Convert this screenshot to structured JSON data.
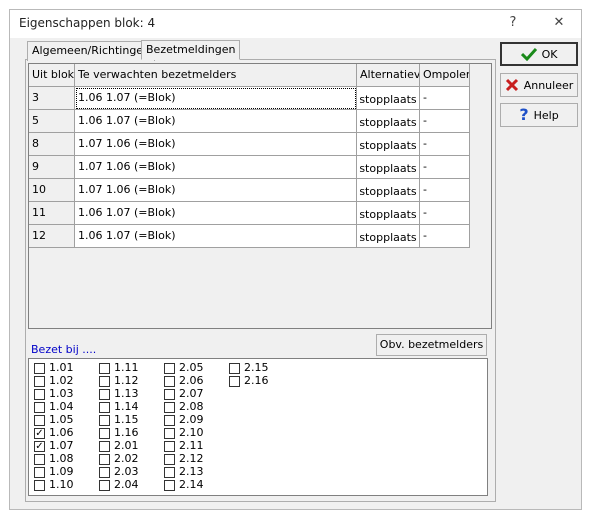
{
  "window": {
    "title": "Eigenschappen blok: 4",
    "help_glyph": "?",
    "close_glyph": "✕"
  },
  "tabs": [
    {
      "label": "Algemeen/Richtingen",
      "active": false
    },
    {
      "label": "Bezetmeldingen",
      "active": true
    }
  ],
  "table": {
    "headers": [
      "Uit blok",
      "Te verwachten bezetmelders",
      "Alternatieve",
      "Ompolen"
    ],
    "rows": [
      {
        "uit_blok": "3",
        "melders": "1.06  1.07 (=Blok)",
        "alternatieve": "stopplaats",
        "ompolen": "-"
      },
      {
        "uit_blok": "5",
        "melders": "1.06  1.07 (=Blok)",
        "alternatieve": "stopplaats",
        "ompolen": "-"
      },
      {
        "uit_blok": "8",
        "melders": "1.07  1.06 (=Blok)",
        "alternatieve": "stopplaats",
        "ompolen": "-"
      },
      {
        "uit_blok": "9",
        "melders": "1.07  1.06 (=Blok)",
        "alternatieve": "stopplaats",
        "ompolen": "-"
      },
      {
        "uit_blok": "10",
        "melders": "1.07  1.06 (=Blok)",
        "alternatieve": "stopplaats",
        "ompolen": "-"
      },
      {
        "uit_blok": "11",
        "melders": "1.06  1.07 (=Blok)",
        "alternatieve": "stopplaats",
        "ompolen": "-"
      },
      {
        "uit_blok": "12",
        "melders": "1.06  1.07 (=Blok)",
        "alternatieve": "stopplaats",
        "ompolen": "-"
      }
    ]
  },
  "bezet": {
    "label": "Bezet bij ....",
    "obv_button": "Obv. bezetmelders",
    "columns": [
      [
        {
          "l": "1.01",
          "c": false
        },
        {
          "l": "1.02",
          "c": false
        },
        {
          "l": "1.03",
          "c": false
        },
        {
          "l": "1.04",
          "c": false
        },
        {
          "l": "1.05",
          "c": false
        },
        {
          "l": "1.06",
          "c": true
        },
        {
          "l": "1.07",
          "c": true
        },
        {
          "l": "1.08",
          "c": false
        },
        {
          "l": "1.09",
          "c": false
        },
        {
          "l": "1.10",
          "c": false
        }
      ],
      [
        {
          "l": "1.11",
          "c": false
        },
        {
          "l": "1.12",
          "c": false
        },
        {
          "l": "1.13",
          "c": false
        },
        {
          "l": "1.14",
          "c": false
        },
        {
          "l": "1.15",
          "c": false
        },
        {
          "l": "1.16",
          "c": false
        },
        {
          "l": "2.01",
          "c": false
        },
        {
          "l": "2.02",
          "c": false
        },
        {
          "l": "2.03",
          "c": false
        },
        {
          "l": "2.04",
          "c": false
        }
      ],
      [
        {
          "l": "2.05",
          "c": false
        },
        {
          "l": "2.06",
          "c": false
        },
        {
          "l": "2.07",
          "c": false
        },
        {
          "l": "2.08",
          "c": false
        },
        {
          "l": "2.09",
          "c": false
        },
        {
          "l": "2.10",
          "c": false
        },
        {
          "l": "2.11",
          "c": false
        },
        {
          "l": "2.12",
          "c": false
        },
        {
          "l": "2.13",
          "c": false
        },
        {
          "l": "2.14",
          "c": false
        }
      ],
      [
        {
          "l": "2.15",
          "c": false
        },
        {
          "l": "2.16",
          "c": false
        }
      ]
    ]
  },
  "buttons": {
    "ok": {
      "label": "OK",
      "icon": "checkmark-icon",
      "color": "#1a8a1a"
    },
    "annuleer": {
      "label": "Annuleer",
      "icon": "cross-icon",
      "color": "#c81e1e"
    },
    "help": {
      "label": "Help",
      "icon": "question-icon",
      "color": "#1e50c8"
    }
  }
}
